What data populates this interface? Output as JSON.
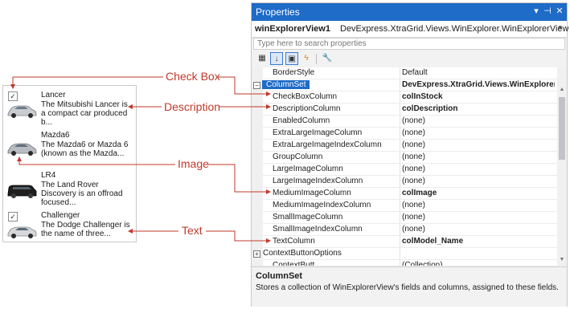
{
  "explorer": {
    "cards": [
      {
        "checked": true,
        "name": "Lancer",
        "description": "The Mitsubishi Lancer is a compact car produced b..."
      },
      {
        "checked": false,
        "name": "Mazda6",
        "description": "The Mazda6 or Mazda 6 (known as the Mazda..."
      },
      {
        "checked": false,
        "name": "LR4",
        "description": "The Land Rover Discovery is an offroad focused..."
      },
      {
        "checked": true,
        "name": "Challenger",
        "description": "The Dodge Challenger is the name of three..."
      }
    ]
  },
  "callouts": {
    "check_box": "Check Box",
    "description": "Description",
    "image": "Image",
    "text": "Text"
  },
  "properties": {
    "title": "Properties",
    "title_buttons": [
      "▾",
      "⊣",
      "✕"
    ],
    "object_name": "winExplorerView1",
    "object_type": "DevExpress.XtraGrid.Views.WinExplorer.WinExplorerView",
    "search_placeholder": "Type here to search properties",
    "rows": [
      {
        "name": "BorderStyle",
        "value": "Default",
        "kind": "plain",
        "bold": false
      },
      {
        "name": "ColumnSet",
        "value": "DevExpress.XtraGrid.Views.WinExplorer.\\",
        "kind": "selected",
        "bold": true,
        "expander": "−"
      },
      {
        "name": "CheckBoxColumn",
        "value": "colInStock",
        "kind": "child",
        "bold": true
      },
      {
        "name": "DescriptionColumn",
        "value": "colDescription",
        "kind": "child",
        "bold": true
      },
      {
        "name": "EnabledColumn",
        "value": "(none)",
        "kind": "child",
        "bold": false
      },
      {
        "name": "ExtraLargeImageColumn",
        "value": "(none)",
        "kind": "child",
        "bold": false
      },
      {
        "name": "ExtraLargeImageIndexColumn",
        "value": "(none)",
        "kind": "child",
        "bold": false
      },
      {
        "name": "GroupColumn",
        "value": "(none)",
        "kind": "child",
        "bold": false
      },
      {
        "name": "LargeImageColumn",
        "value": "(none)",
        "kind": "child",
        "bold": false
      },
      {
        "name": "LargeImageIndexColumn",
        "value": "(none)",
        "kind": "child",
        "bold": false
      },
      {
        "name": "MediumImageColumn",
        "value": "colImage",
        "kind": "child",
        "bold": true
      },
      {
        "name": "MediumImageIndexColumn",
        "value": "(none)",
        "kind": "child",
        "bold": false
      },
      {
        "name": "SmallImageColumn",
        "value": "(none)",
        "kind": "child",
        "bold": false
      },
      {
        "name": "SmallImageIndexColumn",
        "value": "(none)",
        "kind": "child",
        "bold": false
      },
      {
        "name": "TextColumn",
        "value": "colModel_Name",
        "kind": "child",
        "bold": true
      },
      {
        "name": "ContextButtonOptions",
        "value": "",
        "kind": "category",
        "bold": false,
        "expander": "+"
      },
      {
        "name": "ContextButt...",
        "value": "(Collection)",
        "kind": "partial",
        "bold": false
      }
    ],
    "description_title": "ColumnSet",
    "description_text": "Stores a collection of WinExplorerView's fields and columns, assigned to these fields.",
    "colors": {
      "titlebar": "#1e6bc8",
      "selection": "#1e6bc8",
      "callout": "#c0392b"
    }
  }
}
